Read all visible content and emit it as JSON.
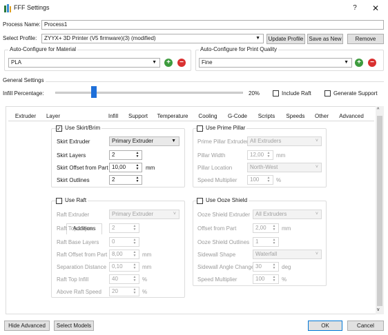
{
  "window": {
    "title": "FFF Settings",
    "help": "?",
    "close": "✕"
  },
  "process_name": {
    "label": "Process Name:",
    "value": "Process1"
  },
  "profile": {
    "label": "Select Profile:",
    "value": "ZYYX+ 3D Printer (V5 firmware)(3) (modified)",
    "update": "Update Profile",
    "save_as": "Save as New",
    "remove": "Remove"
  },
  "material": {
    "title": "Auto-Configure for Material",
    "value": "PLA"
  },
  "quality": {
    "title": "Auto-Configure for Print Quality",
    "value": "Fine"
  },
  "general": {
    "title": "General Settings",
    "infill_label": "Infill Percentage:",
    "infill_value": "20%",
    "infill_fraction": 0.2,
    "include_raft": "Include Raft",
    "generate_support": "Generate Support"
  },
  "tabs": [
    "Extruder",
    "Layer",
    "Additions",
    "Infill",
    "Support",
    "Temperature",
    "Cooling",
    "G-Code",
    "Scripts",
    "Speeds",
    "Other",
    "Advanced"
  ],
  "active_tab": "Additions",
  "skirt": {
    "title": "Use Skirt/Brim",
    "checked": true,
    "extruder_label": "Skirt Extruder",
    "extruder_value": "Primary Extruder",
    "layers_label": "Skirt Layers",
    "layers_value": "2",
    "offset_label": "Skirt Offset from Part",
    "offset_value": "10,00",
    "offset_unit": "mm",
    "outlines_label": "Skirt Outlines",
    "outlines_value": "2"
  },
  "prime": {
    "title": "Use Prime Pillar",
    "checked": false,
    "extruder_label": "Prime Pillar Extruder",
    "extruder_value": "All Extruders",
    "width_label": "Pillar Width",
    "width_value": "12,00",
    "width_unit": "mm",
    "location_label": "Pillar Location",
    "location_value": "North-West",
    "speed_label": "Speed Multiplier",
    "speed_value": "100",
    "speed_unit": "%"
  },
  "raft": {
    "title": "Use Raft",
    "checked": false,
    "extruder_label": "Raft Extruder",
    "extruder_value": "Primary Extruder",
    "top_layers_label": "Raft Top Layers",
    "top_layers_value": "2",
    "base_layers_label": "Raft Base Layers",
    "base_layers_value": "0",
    "offset_label": "Raft Offset from Part",
    "offset_value": "8,00",
    "offset_unit": "mm",
    "separation_label": "Separation Distance",
    "separation_value": "0,10",
    "separation_unit": "mm",
    "top_infill_label": "Raft Top Infill",
    "top_infill_value": "40",
    "top_infill_unit": "%",
    "above_speed_label": "Above Raft Speed",
    "above_speed_value": "20",
    "above_speed_unit": "%"
  },
  "ooze": {
    "title": "Use Ooze Shield",
    "checked": false,
    "extruder_label": "Ooze Shield Extruder",
    "extruder_value": "All Extruders",
    "offset_label": "Offset from Part",
    "offset_value": "2,00",
    "offset_unit": "mm",
    "outlines_label": "Ooze Shield Outlines",
    "outlines_value": "1",
    "sidewall_label": "Sidewall Shape",
    "sidewall_value": "Waterfall",
    "angle_label": "Sidewall Angle Change",
    "angle_value": "30",
    "angle_unit": "deg",
    "speed_label": "Speed Multiplier",
    "speed_value": "100",
    "speed_unit": "%"
  },
  "footer": {
    "hide_advanced": "Hide Advanced",
    "select_models": "Select Models",
    "ok": "OK",
    "cancel": "Cancel"
  },
  "colors": {
    "accent": "#0078d7",
    "slider_thumb": "#1e6fd9",
    "add": "#3d9b3d",
    "remove": "#d93030"
  }
}
